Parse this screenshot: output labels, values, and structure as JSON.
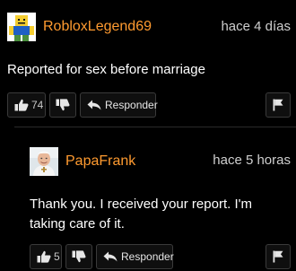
{
  "comments": [
    {
      "username": "RobloxLegend69",
      "timestamp": "hace 4 días",
      "text": "Reported for sex before marriage",
      "likes": "74",
      "reply_label": "Responder",
      "avatar_icon": "roblox-figure-icon"
    },
    {
      "username": "PapaFrank",
      "timestamp": "hace 5 horas",
      "text": "Thank you. I received your report. I'm taking care of it.",
      "likes": "5",
      "reply_label": "Responder",
      "avatar_icon": "pope-photo-icon"
    }
  ],
  "colors": {
    "background": "#000000",
    "username": "#ff9b30",
    "text": "#ffffff",
    "timestamp": "#cfcfcf",
    "button_border": "#3a3a3a"
  }
}
